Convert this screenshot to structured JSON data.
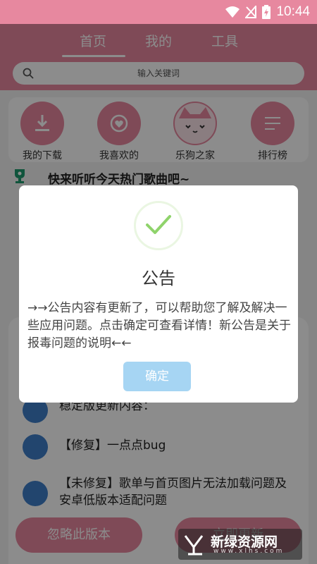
{
  "status_bar": {
    "time": "10:44"
  },
  "tabs": [
    {
      "label": "首页",
      "active": true
    },
    {
      "label": "我的",
      "active": false
    },
    {
      "label": "工具",
      "active": false
    }
  ],
  "search": {
    "placeholder": "输入关键词"
  },
  "quick_items": [
    {
      "label": "我的下载",
      "icon": "download-icon"
    },
    {
      "label": "我喜欢的",
      "icon": "heart-icon"
    },
    {
      "label": "乐狗之家",
      "icon": "cat-avatar-icon"
    },
    {
      "label": "排行榜",
      "icon": "list-icon"
    }
  ],
  "hot": {
    "text": "快来听听今天热门歌曲吧~",
    "icon": "trophy-icon"
  },
  "update_sheet": {
    "items": [
      "稳定版更新内容：",
      "【修复】一点点bug",
      "【未修复】歌单与首页图片无法加载问题及安卓低版本适配问题"
    ],
    "ignore_label": "忽略此版本",
    "update_label": "立即更新"
  },
  "dialog": {
    "title": "公告",
    "body": "→→公告内容有更新了，可以帮助您了解及解决一些应用问题。点击确定可查看详情！新公告是关于报毒问题的说明←←",
    "ok_label": "确定"
  },
  "watermark": {
    "text": "新绿资源网",
    "sub": "www.xlhs.com"
  },
  "colors": {
    "accent": "#e7889f",
    "ok_button": "#a6d5f3",
    "check": "#8fd36b",
    "bullet": "#3e7ec9"
  }
}
